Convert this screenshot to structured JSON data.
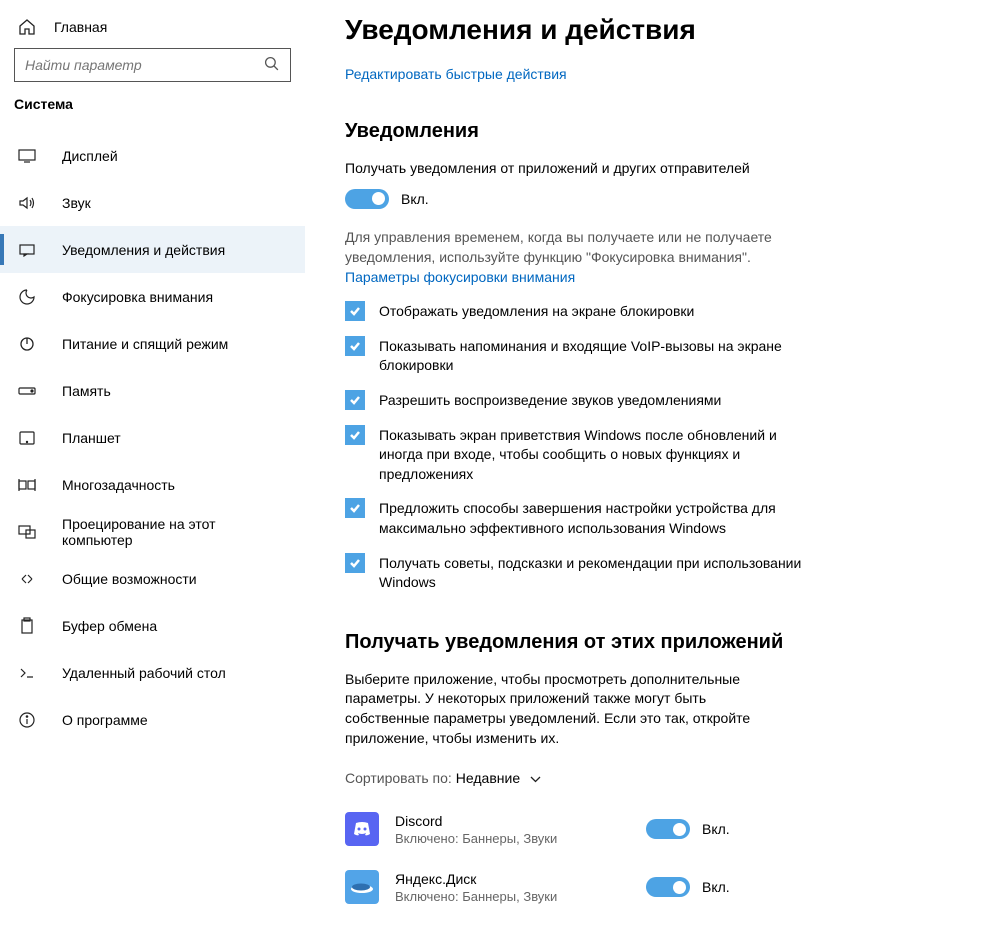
{
  "sidebar": {
    "home": "Главная",
    "search_placeholder": "Найти параметр",
    "heading": "Система",
    "items": [
      {
        "label": "Дисплей",
        "icon": "display"
      },
      {
        "label": "Звук",
        "icon": "sound"
      },
      {
        "label": "Уведомления и действия",
        "icon": "notifications",
        "active": true
      },
      {
        "label": "Фокусировка внимания",
        "icon": "focus"
      },
      {
        "label": "Питание и спящий режим",
        "icon": "power"
      },
      {
        "label": "Память",
        "icon": "storage"
      },
      {
        "label": "Планшет",
        "icon": "tablet"
      },
      {
        "label": "Многозадачность",
        "icon": "multitask"
      },
      {
        "label": "Проецирование на этот компьютер",
        "icon": "project"
      },
      {
        "label": "Общие возможности",
        "icon": "shared"
      },
      {
        "label": "Буфер обмена",
        "icon": "clipboard"
      },
      {
        "label": "Удаленный рабочий стол",
        "icon": "remote"
      },
      {
        "label": "О программе",
        "icon": "about"
      }
    ]
  },
  "page": {
    "title": "Уведомления и действия",
    "edit_link": "Редактировать быстрые действия",
    "notifications": {
      "heading": "Уведомления",
      "receive_text": "Получать уведомления от приложений и других отправителей",
      "toggle_state": "Вкл.",
      "description": "Для управления временем, когда вы получаете или не получаете уведомления, используйте функцию \"Фокусировка внимания\".",
      "focus_link": "Параметры фокусировки внимания",
      "checks": [
        "Отображать уведомления на экране блокировки",
        "Показывать напоминания и входящие VoIP-вызовы на экране блокировки",
        "Разрешить  воспроизведение звуков уведомлениями",
        "Показывать экран приветствия Windows после обновлений и иногда при входе, чтобы сообщить о новых функциях и предложениях",
        "Предложить способы завершения настройки устройства для максимально эффективного использования Windows",
        "Получать советы, подсказки и рекомендации при использовании Windows"
      ]
    },
    "apps_section": {
      "heading": "Получать уведомления от этих приложений",
      "description": "Выберите приложение, чтобы просмотреть дополнительные параметры. У некоторых приложений также могут быть собственные параметры уведомлений. Если это так, откройте приложение, чтобы изменить их.",
      "sort_label": "Сортировать по:",
      "sort_value": "Недавние",
      "apps": [
        {
          "name": "Discord",
          "sub": "Включено: Баннеры, Звуки",
          "state": "Вкл.",
          "icon": "discord"
        },
        {
          "name": "Яндекс.Диск",
          "sub": "Включено: Баннеры, Звуки",
          "state": "Вкл.",
          "icon": "yandex"
        }
      ]
    }
  }
}
